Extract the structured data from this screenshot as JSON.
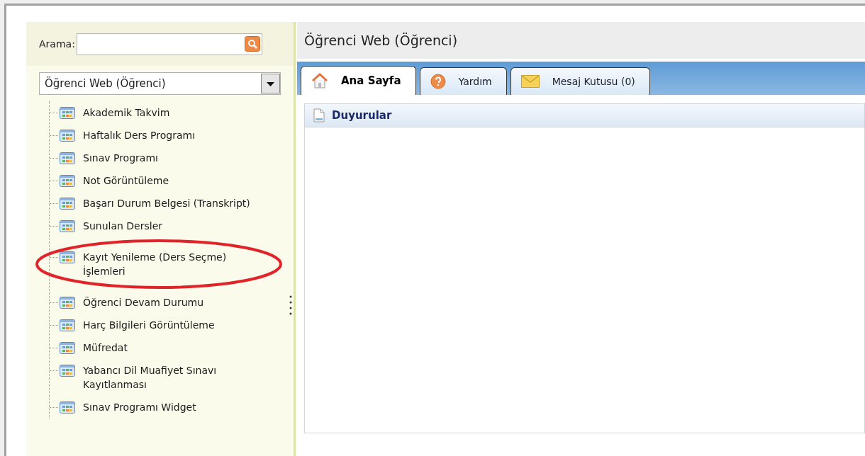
{
  "sidebar": {
    "search": {
      "label": "Arama:"
    },
    "module_select": {
      "value": "Öğrenci Web (Öğrenci)"
    },
    "items": [
      {
        "label": "Akademik Takvim",
        "circled": false
      },
      {
        "label": "Haftalık Ders Programı",
        "circled": false
      },
      {
        "label": "Sınav Programı",
        "circled": false
      },
      {
        "label": "Not Görüntüleme",
        "circled": false
      },
      {
        "label": "Başarı Durum Belgesi (Transkript)",
        "circled": false
      },
      {
        "label": "Sunulan Dersler",
        "circled": false
      },
      {
        "label": "Kayıt Yenileme (Ders Seçme) İşlemleri",
        "circled": true
      },
      {
        "label": "Öğrenci Devam Durumu",
        "circled": false
      },
      {
        "label": "Harç Bilgileri Görüntüleme",
        "circled": false
      },
      {
        "label": "Müfredat",
        "circled": false
      },
      {
        "label": "Yabancı Dil Muafiyet Sınavı Kayıtlanması",
        "circled": false
      },
      {
        "label": "Sınav Programı Widget",
        "circled": false
      }
    ]
  },
  "main": {
    "title": "Öğrenci Web (Öğrenci)",
    "tabs": [
      {
        "label": "Ana Sayfa",
        "selected": true
      },
      {
        "label": "Yardım",
        "selected": false
      },
      {
        "label": "Mesaj Kutusu (0)",
        "selected": false
      }
    ],
    "panel": {
      "title": "Duyurular"
    }
  }
}
